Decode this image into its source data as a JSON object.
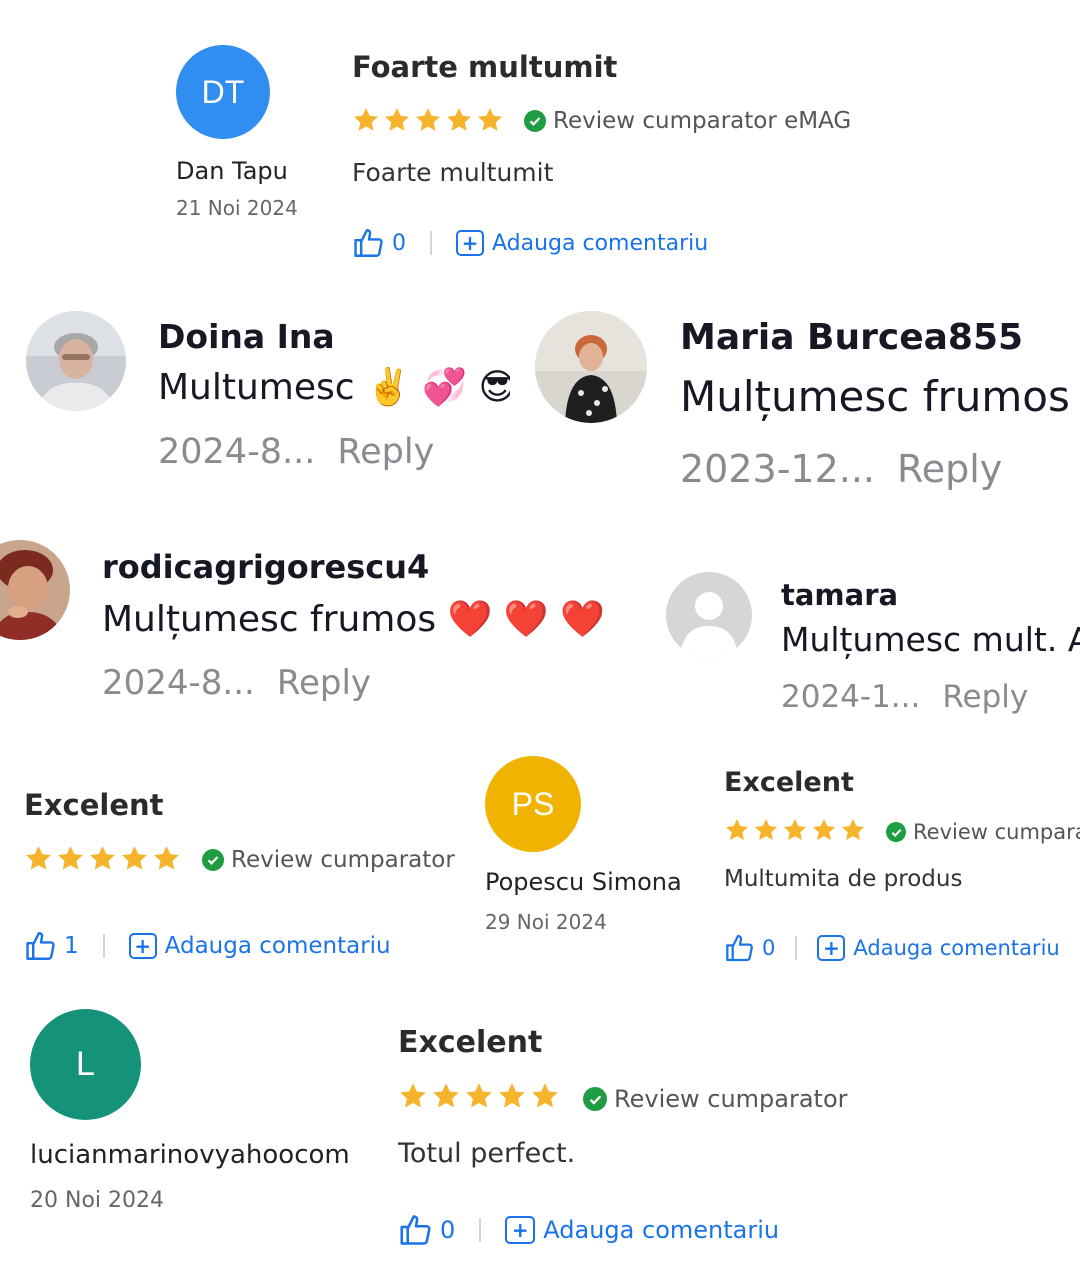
{
  "review_top": {
    "initials": "DT",
    "avatar_color": "#2f8ef0",
    "name": "Dan Tapu",
    "date": "21 Noi 2024",
    "title": "Foarte multumit",
    "rating": 5,
    "badge": "Review cumparator eMAG",
    "text": "Foarte multumit",
    "likes": "0",
    "comment_label": "Adauga comentariu"
  },
  "comment_doina": {
    "name": "Doina Ina",
    "message": "Multumesc ✌️ 💞 😎",
    "date": "2024-8...",
    "reply": "Reply"
  },
  "comment_maria": {
    "name": "Maria Burcea855",
    "message": "Mulțumesc frumos",
    "date": "2023-12...",
    "reply": "Reply"
  },
  "comment_rodica": {
    "name": "rodicagrigorescu4",
    "message": "Mulțumesc frumos ❤️ ❤️ ❤️",
    "date": "2024-8...",
    "reply": "Reply"
  },
  "comment_tamara": {
    "name": "tamara",
    "message": "Mulțumesc mult. A",
    "date": "2024-1...",
    "reply": "Reply"
  },
  "review_left": {
    "title": "Excelent",
    "rating": 5,
    "badge": "Review cumparator",
    "likes": "1",
    "comment_label": "Adauga comentariu"
  },
  "review_popescu": {
    "initials": "PS",
    "avatar_color": "#f0b400",
    "name": "Popescu Simona",
    "date": "29 Noi 2024",
    "title": "Excelent",
    "rating": 5,
    "badge": "Review cumparator",
    "text": "Multumita de produs",
    "likes": "0",
    "comment_label": "Adauga comentariu"
  },
  "review_lucian": {
    "initials": "L",
    "avatar_color": "#15927a",
    "name": "lucianmarinovyahoocom",
    "date": "20 Noi 2024",
    "title": "Excelent",
    "rating": 5,
    "badge": "Review cumparator",
    "text": "Totul perfect.",
    "likes": "0",
    "comment_label": "Adauga comentariu"
  },
  "colors": {
    "star": "#f7b32b",
    "verified": "#1f9d42",
    "link": "#1a73e8"
  }
}
